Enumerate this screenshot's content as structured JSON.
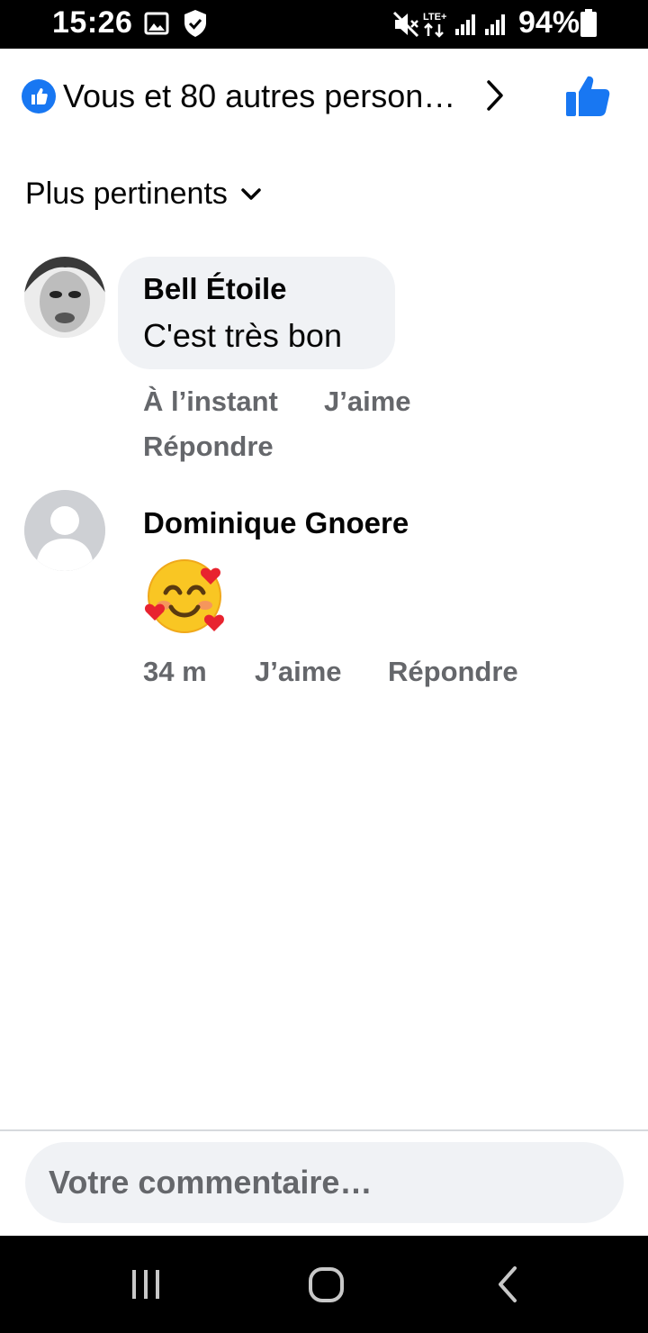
{
  "status_bar": {
    "time": "15:26",
    "battery": "94%",
    "icons": [
      "gallery-icon",
      "shield-check-icon",
      "mute-icon",
      "lte-icon",
      "signal-icon",
      "signal-icon",
      "battery-icon"
    ]
  },
  "reactions": {
    "summary": "Vous et 80 autres person…",
    "icon": "like-badge-icon",
    "chevron": "chevron-right-icon",
    "like_button_icon": "thumbs-up-icon",
    "accent_color": "#1877f2"
  },
  "sort": {
    "label": "Plus pertinents",
    "icon": "chevron-down-icon"
  },
  "comments": [
    {
      "author": "Bell Étoile",
      "text": "C'est très bon",
      "time": "À l’instant",
      "like_label": "J’aime",
      "reply_label": "Répondre"
    },
    {
      "author": "Dominique Gnoere",
      "emoji": "🥰",
      "time": "34 m",
      "like_label": "J’aime",
      "reply_label": "Répondre"
    }
  ],
  "composer": {
    "placeholder": "Votre commentaire…"
  },
  "nav_bar": {
    "icons": [
      "recent-apps-icon",
      "home-icon",
      "back-icon"
    ]
  }
}
